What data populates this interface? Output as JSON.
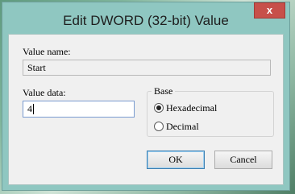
{
  "window": {
    "title": "Edit DWORD (32-bit) Value",
    "close_glyph": "x"
  },
  "form": {
    "value_name_label": "Value name:",
    "value_name": "Start",
    "value_data_label": "Value data:",
    "value_data": "4",
    "base": {
      "legend": "Base",
      "options": [
        {
          "label": "Hexadecimal",
          "selected": true
        },
        {
          "label": "Decimal",
          "selected": false
        }
      ]
    }
  },
  "buttons": {
    "ok": "OK",
    "cancel": "Cancel"
  },
  "colors": {
    "titlebar": "#8fc7c1",
    "close": "#c7504a"
  }
}
